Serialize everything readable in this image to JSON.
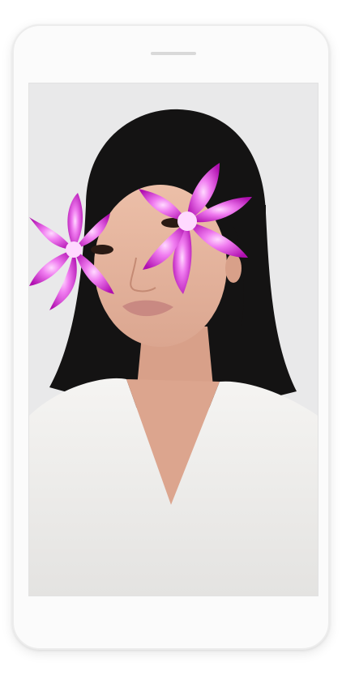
{
  "device": {
    "frame_color": "#fbfbfb",
    "speaker_color": "#d9d9d9"
  },
  "camera_view": {
    "content": "selfie-portrait-with-ar-flower-effect",
    "effect": {
      "icon": "orchid-flower-icon",
      "colors": {
        "petal": "#d81fd2",
        "petal_light": "#f07cf0",
        "center": "#ffd9ff"
      }
    },
    "colors": {
      "background": "#e9e9ea",
      "hair": "#141313",
      "skin": "#e7b7a0",
      "sweater": "#f3f2f0",
      "lips": "#c98982"
    }
  }
}
